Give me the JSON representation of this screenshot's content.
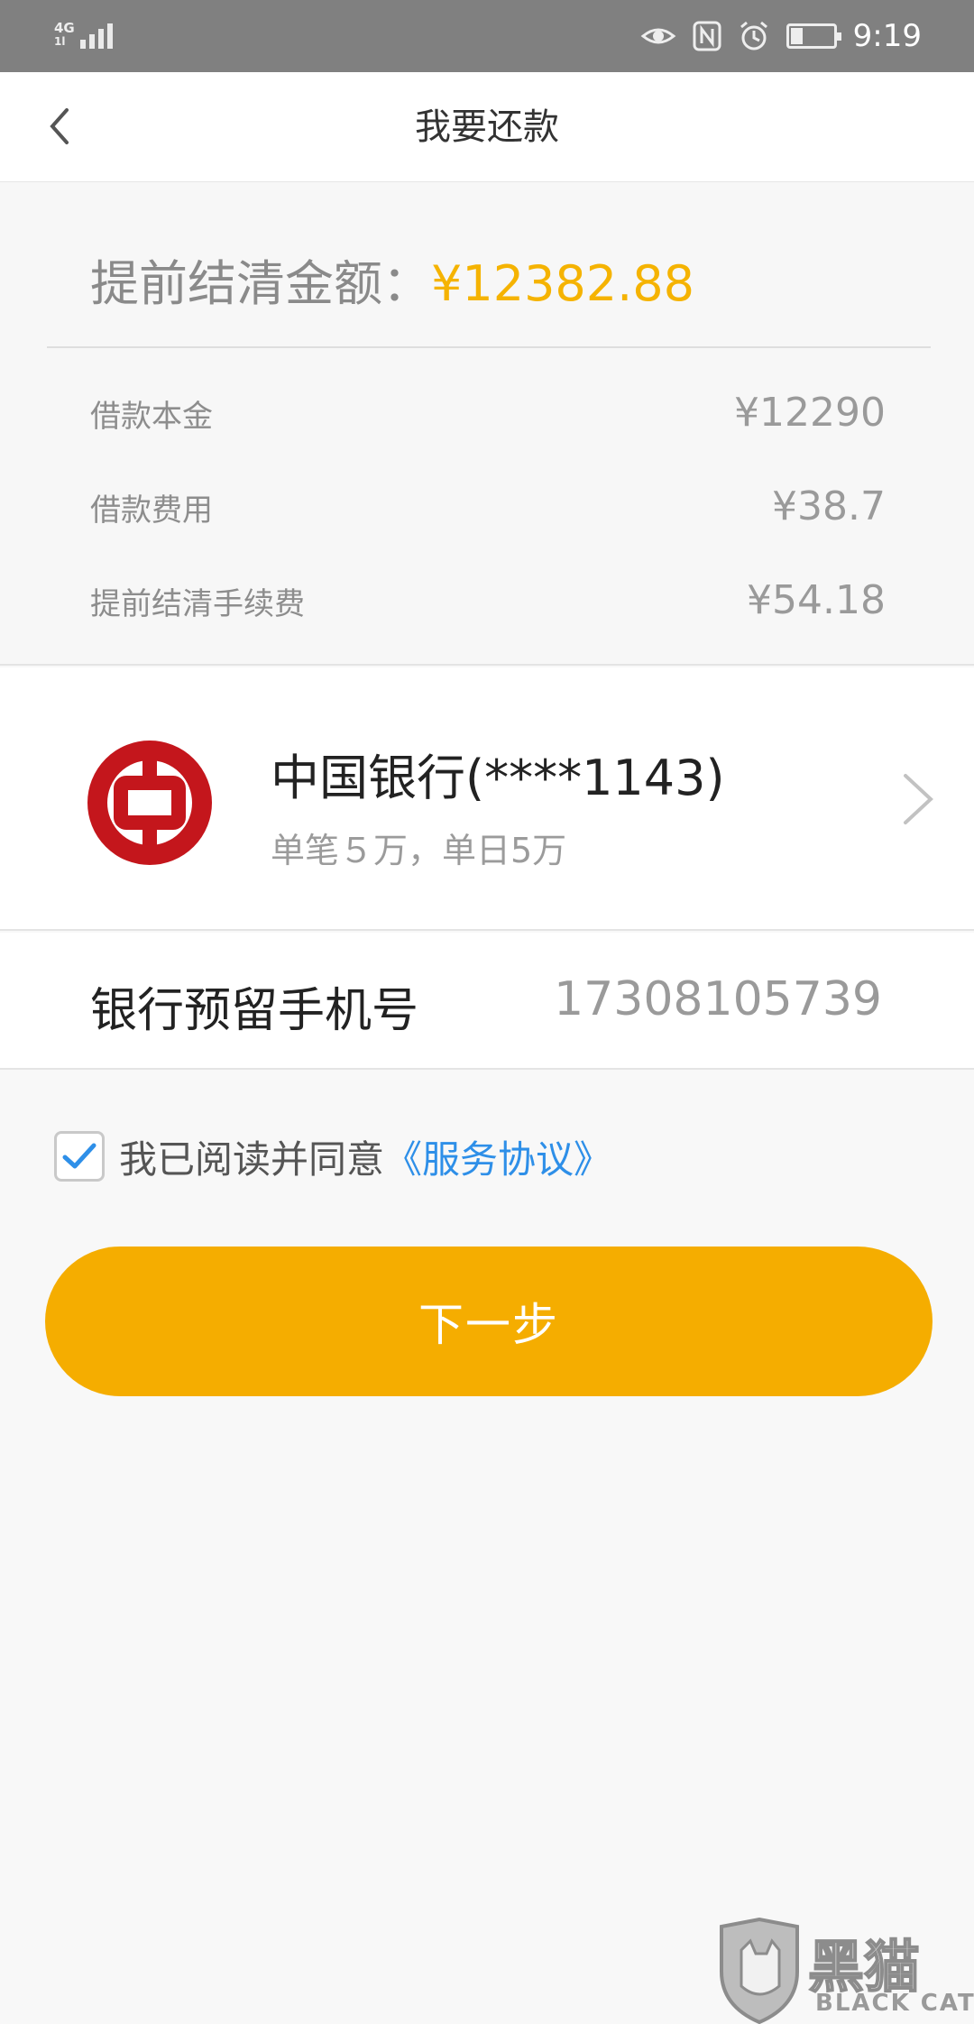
{
  "status_bar": {
    "network_type": "4G",
    "network_sub": "1l",
    "time": "9:19",
    "battery_level_percent": 30,
    "icons": [
      "signal-icon",
      "eye-icon",
      "nfc-icon",
      "alarm-icon",
      "battery-icon"
    ]
  },
  "header": {
    "title": "我要还款",
    "back_icon": "chevron-left-icon"
  },
  "summary": {
    "total_label": "提前结清金额：",
    "total_amount": "¥12382.88",
    "rows": [
      {
        "label": "借款本金",
        "value": "¥12290"
      },
      {
        "label": "借款费用",
        "value": "¥38.7"
      },
      {
        "label": "提前结清手续费",
        "value": "¥54.18"
      }
    ]
  },
  "bank": {
    "name": "中国银行(****1143)",
    "limit": "单笔５万，单日5万",
    "logo_icon": "bank-of-china-logo",
    "logo_color": "#c4161c"
  },
  "phone": {
    "label": "银行预留手机号",
    "value": "17308105739"
  },
  "agreement": {
    "checked": true,
    "text": "我已阅读并同意",
    "link": "《服务协议》"
  },
  "next_button": {
    "label": "下一步"
  },
  "watermark": {
    "text_cn": "黑猫",
    "text_en": "BLACK CAT"
  },
  "colors": {
    "accent": "#f5ad00",
    "amount": "#f5b301",
    "link": "#2e8fe8",
    "check": "#2e8fe8"
  }
}
